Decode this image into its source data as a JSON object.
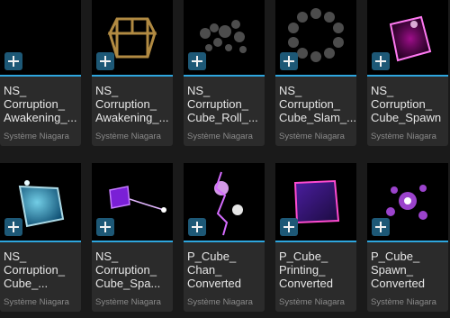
{
  "assets": [
    {
      "name": "NS_\nCorruption_\nAwakening_...",
      "type": "Système Niagara",
      "thumbnail": "empty-black",
      "add_icon": "plus-icon"
    },
    {
      "name": "NS_\nCorruption_\nAwakening_...",
      "type": "Système Niagara",
      "thumbnail": "gold-wireframe-cube",
      "add_icon": "plus-icon"
    },
    {
      "name": "NS_\nCorruption_\nCube_Roll_...",
      "type": "Système Niagara",
      "thumbnail": "grey-smoke-puffs",
      "add_icon": "plus-icon"
    },
    {
      "name": "NS_\nCorruption_\nCube_Slam_...",
      "type": "Système Niagara",
      "thumbnail": "grey-smoke-ring",
      "add_icon": "plus-icon"
    },
    {
      "name": "NS_\nCorruption_\nCube_Spawn",
      "type": "Système Niagara",
      "thumbnail": "magenta-glow-cube",
      "add_icon": "plus-icon"
    },
    {
      "name": "NS_\nCorruption_\nCube_...",
      "type": "Système Niagara",
      "thumbnail": "cyan-glow-cube",
      "add_icon": "plus-icon"
    },
    {
      "name": "NS_\nCorruption_\nCube_Spa...",
      "type": "Système Niagara",
      "thumbnail": "purple-cube-beam",
      "add_icon": "plus-icon"
    },
    {
      "name": "P_Cube_\nChan_\nConverted",
      "type": "Système Niagara",
      "thumbnail": "purple-lightning",
      "add_icon": "plus-icon"
    },
    {
      "name": "P_Cube_\nPrinting_\nConverted",
      "type": "Système Niagara",
      "thumbnail": "purple-solid-cube",
      "add_icon": "plus-icon"
    },
    {
      "name": "P_Cube_\nSpawn_\nConverted",
      "type": "Système Niagara",
      "thumbnail": "purple-sparks",
      "add_icon": "plus-icon"
    }
  ],
  "colors": {
    "accent": "#2ea6de",
    "card_bg": "#2b2b2b",
    "panel_bg": "#1a1a1a",
    "type_text": "#8a8a8a"
  }
}
